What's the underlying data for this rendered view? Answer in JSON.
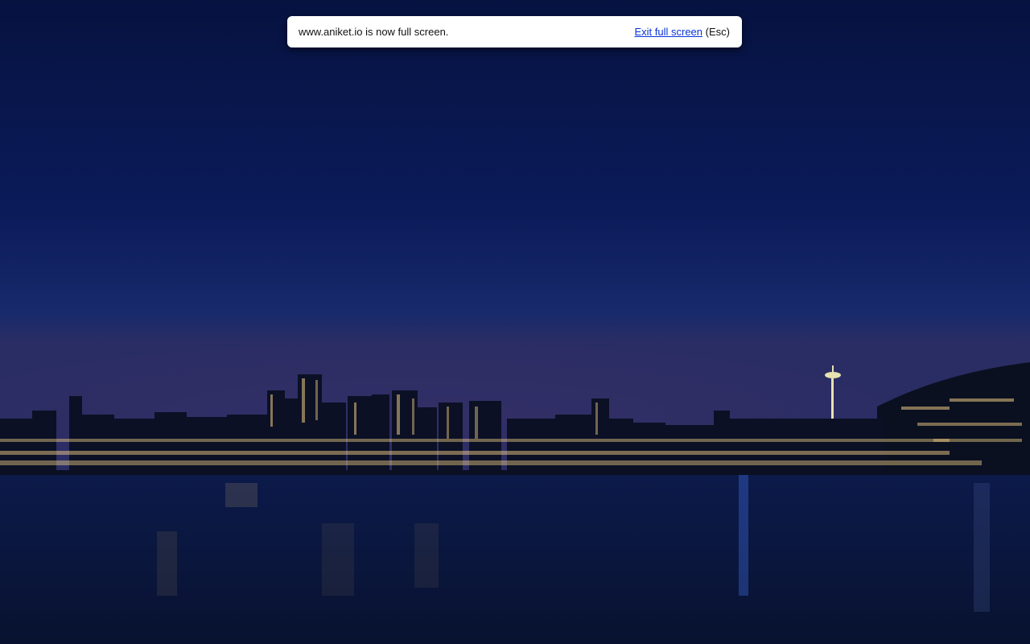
{
  "fullscreen_banner": {
    "message": "www.aniket.io is now full screen.",
    "exit_label": "Exit full screen",
    "shortcut_hint": "(Esc)"
  },
  "background": {
    "description_icon": "night-city-skyline-photo",
    "sky_color_top": "#071447",
    "sky_color_bottom": "#1a2a6e",
    "water_color": "#0b1a44"
  }
}
